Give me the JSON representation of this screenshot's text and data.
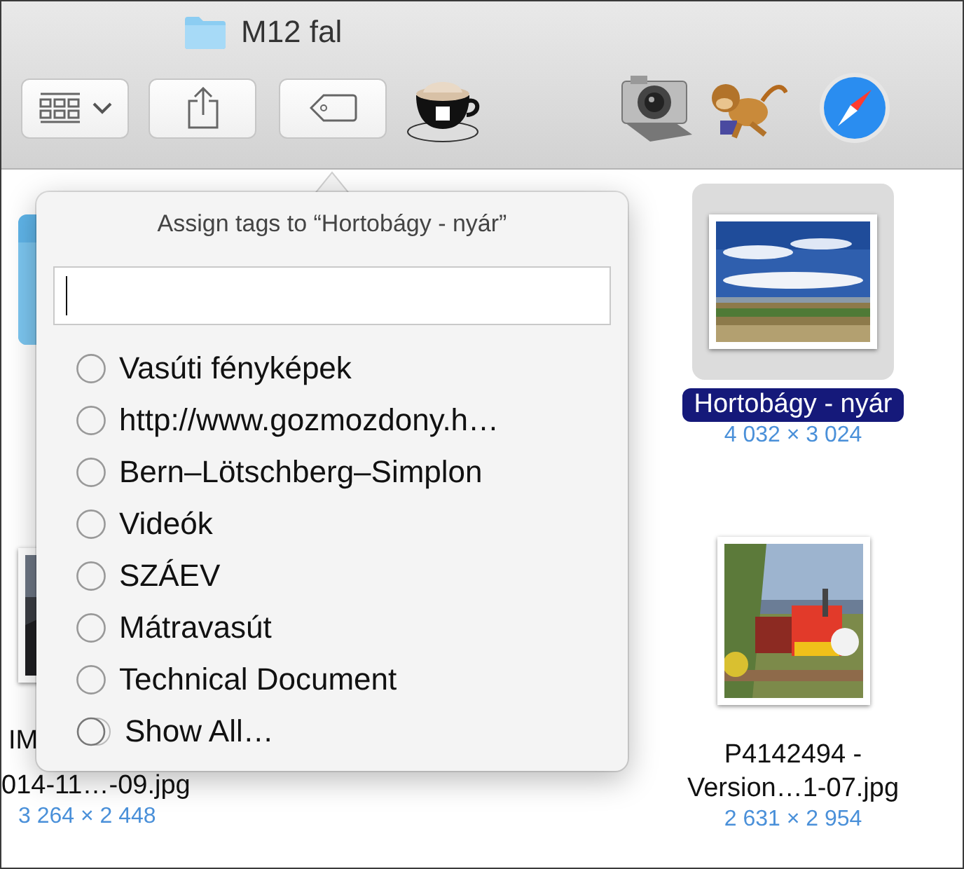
{
  "window": {
    "title": "M12 fal"
  },
  "popover": {
    "title": "Assign tags to “Hortobágy - nyár”",
    "tags": [
      {
        "kind": "tag",
        "label": "Vasúti fényképek"
      },
      {
        "kind": "tag",
        "label": "http://www.gozmozdony.h…"
      },
      {
        "kind": "tag",
        "label": "Bern–Lötschberg–Simplon"
      },
      {
        "kind": "tag",
        "label": "Videók"
      },
      {
        "kind": "tag",
        "label": "SZÁEV"
      },
      {
        "kind": "tag",
        "label": "Mátravasút"
      },
      {
        "kind": "tag",
        "label": "Technical Document"
      },
      {
        "kind": "more",
        "label": "Show All…"
      }
    ]
  },
  "files": [
    {
      "kind": "folder",
      "selected": false
    },
    {
      "kind": "landscape",
      "name_lines": [
        "Hortobágy - nyár"
      ],
      "dimensions": "4 032 × 3 024",
      "selected": true
    },
    {
      "kind": "dark",
      "name_lines": [
        "IM",
        "014-11…-09.jpg"
      ],
      "dimensions": "3 264 × 2 448",
      "selected": false
    },
    {
      "kind": "train",
      "name_lines": [
        "P4142494 -",
        "Version…1-07.jpg"
      ],
      "dimensions": "2 631 × 2 954",
      "selected": false
    }
  ]
}
